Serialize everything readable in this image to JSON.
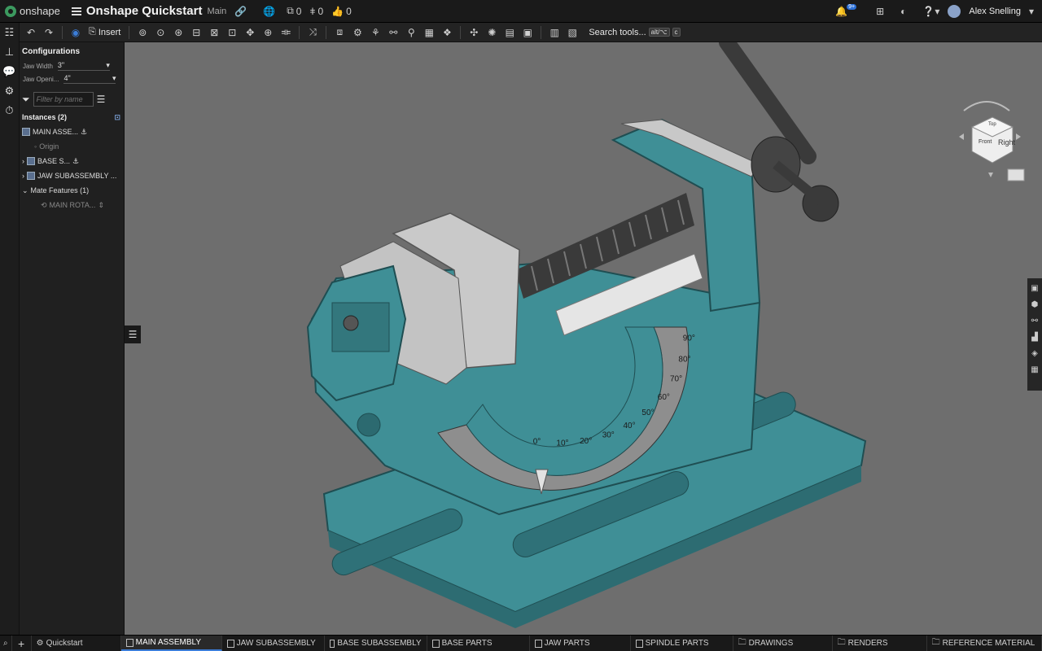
{
  "app": {
    "brand": "onshape",
    "title": "Onshape Quickstart",
    "branch": "Main"
  },
  "topbar": {
    "versions_count": "0",
    "branch_count": "0",
    "likes_count": "0",
    "notifications_badge": "9+",
    "user": "Alex Snelling"
  },
  "toolbar": {
    "insert_label": "Insert",
    "search_label": "Search tools...",
    "shortcut_1": "alt/⌥",
    "shortcut_2": "c"
  },
  "panel": {
    "configurations_title": "Configurations",
    "config_rows": [
      {
        "label": "Jaw Width",
        "value": "3\""
      },
      {
        "label": "Jaw Openi...",
        "value": "4\""
      }
    ],
    "filter_placeholder": "Filter by name",
    "instances_header": "Instances (2)",
    "tree": [
      {
        "label": "MAIN ASSE..."
      },
      {
        "label": "Origin"
      },
      {
        "label": "BASE S..."
      },
      {
        "label": "JAW SUBASSEMBLY ..."
      },
      {
        "label": "Mate Features (1)"
      },
      {
        "label": "MAIN ROTA..."
      }
    ]
  },
  "viewcube": {
    "face_label": "Right",
    "top_label": "Top",
    "front_label": "Front"
  },
  "protractor": {
    "ticks": [
      "0°",
      "10°",
      "20°",
      "30°",
      "40°",
      "50°",
      "60°",
      "70°",
      "80°",
      "90°"
    ]
  },
  "tabs": [
    {
      "label": "Quickstart"
    },
    {
      "label": "MAIN ASSEMBLY"
    },
    {
      "label": "JAW SUBASSEMBLY"
    },
    {
      "label": "BASE SUBASSEMBLY"
    },
    {
      "label": "BASE PARTS"
    },
    {
      "label": "JAW PARTS"
    },
    {
      "label": "SPINDLE PARTS"
    },
    {
      "label": "DRAWINGS"
    },
    {
      "label": "RENDERS"
    },
    {
      "label": "REFERENCE MATERIAL"
    }
  ],
  "colors": {
    "part_teal": "#3f8f96",
    "viewport_bg": "#6e6e6e",
    "active_tab": "#3b7dd8"
  }
}
